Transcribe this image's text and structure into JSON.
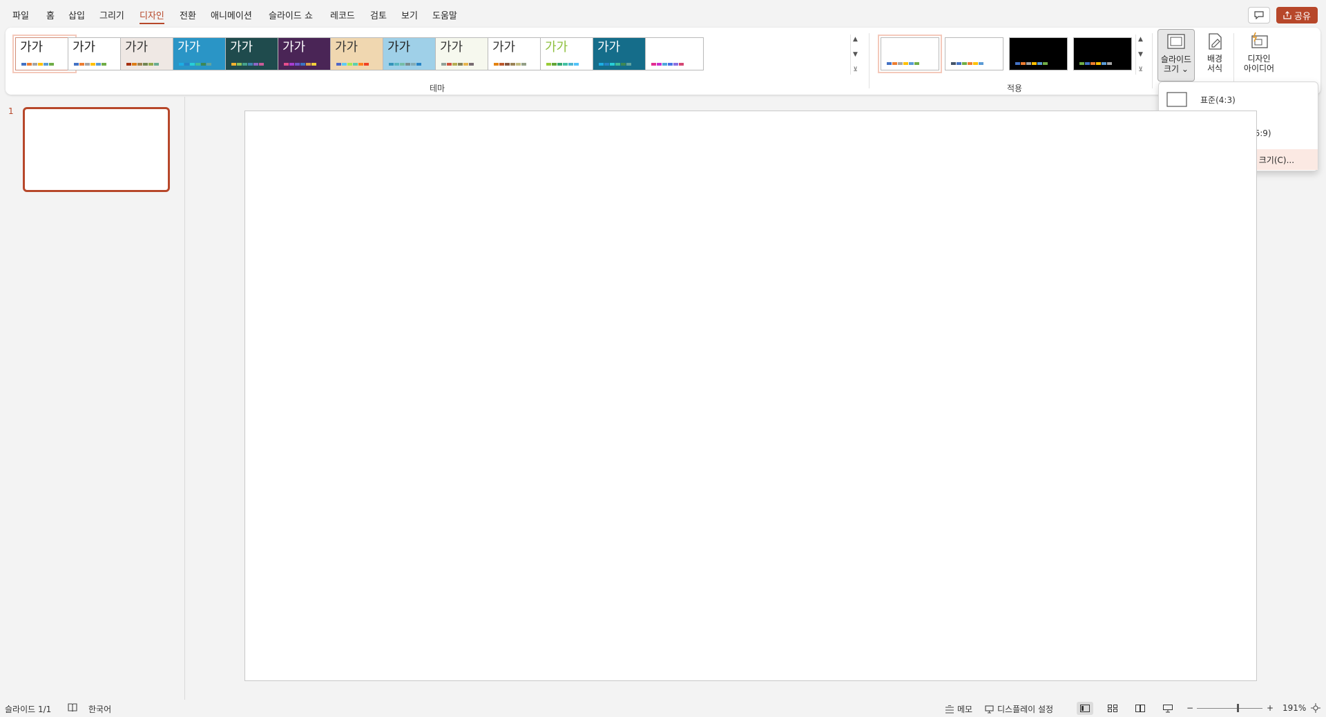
{
  "menu": {
    "tabs": [
      {
        "label": "파일"
      },
      {
        "label": "홈"
      },
      {
        "label": "삽입"
      },
      {
        "label": "그리기"
      },
      {
        "label": "디자인",
        "active": true
      },
      {
        "label": "전환"
      },
      {
        "label": "애니메이션"
      },
      {
        "label": "슬라이드 쇼"
      },
      {
        "label": "레코드"
      },
      {
        "label": "검토"
      },
      {
        "label": "보기"
      },
      {
        "label": "도움말"
      }
    ],
    "share_label": "공유",
    "comment_icon": "comment-icon",
    "share_icon": "share-icon"
  },
  "ribbon": {
    "themes_group_label": "테마",
    "variants_group_label": "적용",
    "theme_thumbnails": [
      {
        "text": "가가",
        "bg": "#ffffff",
        "fg": "#222222",
        "selected": true
      },
      {
        "text": "가가",
        "bg": "#ffffff",
        "fg": "#222222"
      },
      {
        "text": "가가",
        "bg": "#efe8e4",
        "fg": "#333333"
      },
      {
        "text": "가가",
        "bg": "#2a95c6",
        "fg": "#ffffff"
      },
      {
        "text": "가가",
        "bg": "#1f4b4d",
        "fg": "#ffffff"
      },
      {
        "text": "가가",
        "bg": "#4a2556",
        "fg": "#ffffff"
      },
      {
        "text": "가가",
        "bg": "#f0d7b0",
        "fg": "#333333"
      },
      {
        "text": "가가",
        "bg": "#9fd0e8",
        "fg": "#222222"
      },
      {
        "text": "가가",
        "bg": "#f6f8ee",
        "fg": "#333333"
      },
      {
        "text": "가가",
        "bg": "#ffffff",
        "fg": "#333333"
      },
      {
        "text": "가가",
        "bg": "#ffffff",
        "fg": "#8dbf3c"
      },
      {
        "text": "가가",
        "bg": "#156d8a",
        "fg": "#ffffff"
      },
      {
        "text": "",
        "bg": "#ffffff",
        "fg": "#333333"
      }
    ],
    "variant_thumbnails": [
      {
        "bg": "#ffffff",
        "selected": true
      },
      {
        "bg": "#ffffff"
      },
      {
        "bg": "#000000"
      },
      {
        "bg": "#000000"
      }
    ],
    "slide_size_button": {
      "line1": "슬라이드",
      "line2": "크기 ⌄",
      "icon": "slide-size-icon"
    },
    "format_background_button": {
      "line1": "배경",
      "line2": "서식",
      "icon": "format-background-icon"
    },
    "designer_button": {
      "line1": "디자인",
      "line2": "아이디어",
      "icon": "designer-icon"
    }
  },
  "slide_size_menu": {
    "items": [
      {
        "label": "표준(4:3)",
        "icon": "standard-4-3-icon"
      },
      {
        "label": "와이드스크린(16:9)",
        "icon": "widescreen-16-9-icon",
        "selected": true
      }
    ],
    "custom_label": "사용자 지정 슬라이드 크기(C)..."
  },
  "thumbnails": {
    "slides": [
      {
        "number": "1"
      }
    ]
  },
  "statusbar": {
    "slide_indicator": "슬라이드 1/1",
    "language": "한국어",
    "notes_label": "메모",
    "display_settings_label": "디스플레이 설정",
    "zoom_minus": "−",
    "zoom_plus": "+",
    "zoom_level": "191%"
  },
  "colors": {
    "accent": "#b7472a",
    "accent_light": "#fbe9e3"
  }
}
